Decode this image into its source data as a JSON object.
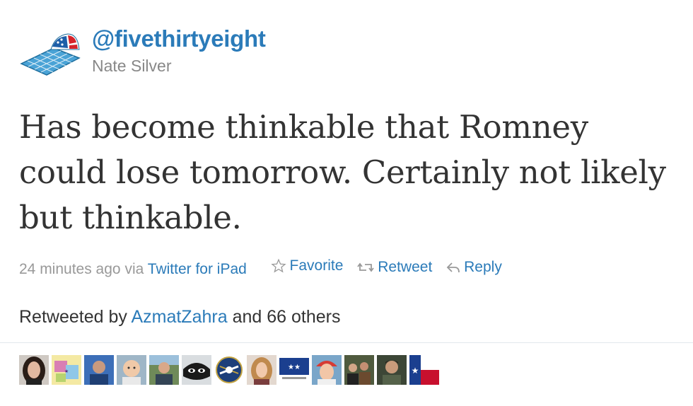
{
  "tweet": {
    "handle": "@fivethirtyeight",
    "name": "Nate Silver",
    "text": "Has become thinkable that Romney could lose tomorrow. Certainly not likely but thinkable.",
    "time": "24 minutes ago",
    "via_prefix": "via",
    "client": "Twitter for iPad",
    "actions": {
      "favorite": "Favorite",
      "retweet": "Retweet",
      "reply": "Reply"
    },
    "retweeted": {
      "prefix": "Retweeted by",
      "user": "AzmatZahra",
      "suffix": "and 66 others"
    }
  },
  "retweeter_avatars": [
    {
      "icon": "avatar-woman-dark-hair"
    },
    {
      "icon": "avatar-collage"
    },
    {
      "icon": "avatar-man-blue"
    },
    {
      "icon": "avatar-baby"
    },
    {
      "icon": "avatar-man-outdoor"
    },
    {
      "icon": "avatar-face-dark"
    },
    {
      "icon": "avatar-sabres-logo"
    },
    {
      "icon": "avatar-woman-blonde"
    },
    {
      "icon": "avatar-flag-blue"
    },
    {
      "icon": "avatar-woman-red-hat"
    },
    {
      "icon": "avatar-group"
    },
    {
      "icon": "avatar-man-portrait"
    },
    {
      "icon": "avatar-texas-flag"
    }
  ],
  "colors": {
    "link": "#2b7bb9",
    "text": "#333333",
    "meta": "#999999"
  }
}
